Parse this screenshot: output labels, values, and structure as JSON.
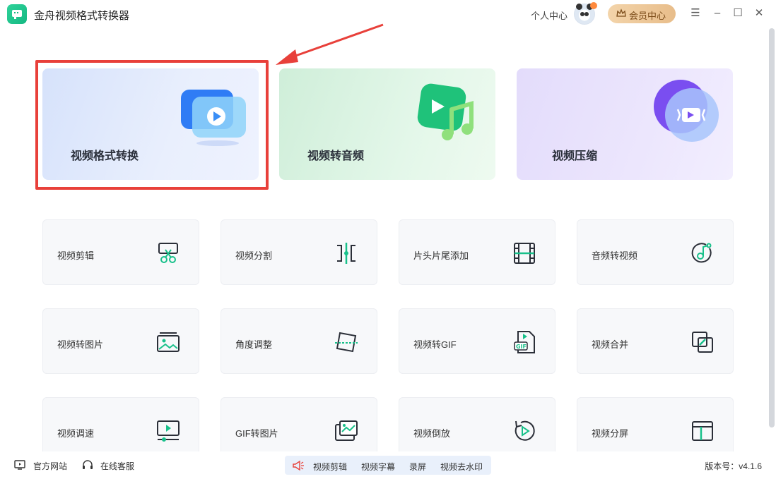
{
  "app": {
    "title": "金舟视频格式转换器"
  },
  "header": {
    "user_center": "个人中心",
    "vip_button": "会员中心"
  },
  "features": [
    {
      "label": "视频格式转换"
    },
    {
      "label": "视频转音频"
    },
    {
      "label": "视频压缩"
    }
  ],
  "tools": [
    {
      "label": "视频剪辑",
      "icon": "scissors-icon"
    },
    {
      "label": "视频分割",
      "icon": "split-icon"
    },
    {
      "label": "片头片尾添加",
      "icon": "film-icon"
    },
    {
      "label": "音频转视频",
      "icon": "music-note-icon"
    },
    {
      "label": "视频转图片",
      "icon": "image-icon"
    },
    {
      "label": "角度调整",
      "icon": "rotate-angle-icon"
    },
    {
      "label": "视频转GIF",
      "icon": "gif-file-icon"
    },
    {
      "label": "视频合并",
      "icon": "merge-icon"
    },
    {
      "label": "视频调速",
      "icon": "speed-icon"
    },
    {
      "label": "GIF转图片",
      "icon": "gif-image-icon"
    },
    {
      "label": "视频倒放",
      "icon": "reverse-play-icon"
    },
    {
      "label": "视频分屏",
      "icon": "split-screen-icon"
    }
  ],
  "footer": {
    "website": "官方网站",
    "support": "在线客服",
    "promo_items": [
      "视频剪辑",
      "视频字幕",
      "录屏",
      "视频去水印"
    ],
    "version": "版本号：v4.1.6"
  },
  "colors": {
    "accent_green": "#18c08a",
    "highlight_red": "#e8403a",
    "vip_gold": "#e8bd8a"
  }
}
